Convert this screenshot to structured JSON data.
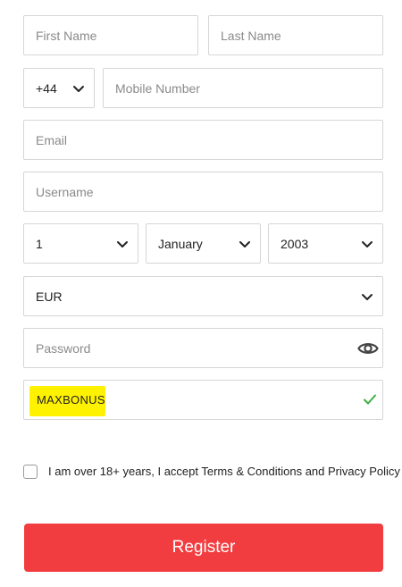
{
  "form": {
    "first_name": {
      "placeholder": "First Name"
    },
    "last_name": {
      "placeholder": "Last Name"
    },
    "phone_code": {
      "value": "+44"
    },
    "mobile": {
      "placeholder": "Mobile Number"
    },
    "email": {
      "placeholder": "Email"
    },
    "username": {
      "placeholder": "Username"
    },
    "dob": {
      "day": "1",
      "month": "January",
      "year": "2003"
    },
    "currency": {
      "value": "EUR"
    },
    "password": {
      "placeholder": "Password"
    },
    "promo_code": {
      "value": "MAXBONUS",
      "status": "valid"
    },
    "terms_label": "I am over 18+ years, I accept Terms & Conditions and Privacy Policy",
    "register_label": "Register"
  },
  "colors": {
    "accent": "#f23d40",
    "highlight": "#fff200",
    "valid": "#3cb043",
    "border": "#d6d6d6"
  },
  "icons": {
    "dropdown": "chevron-down-icon",
    "password_toggle": "eye-icon",
    "valid": "checkmark-icon"
  }
}
